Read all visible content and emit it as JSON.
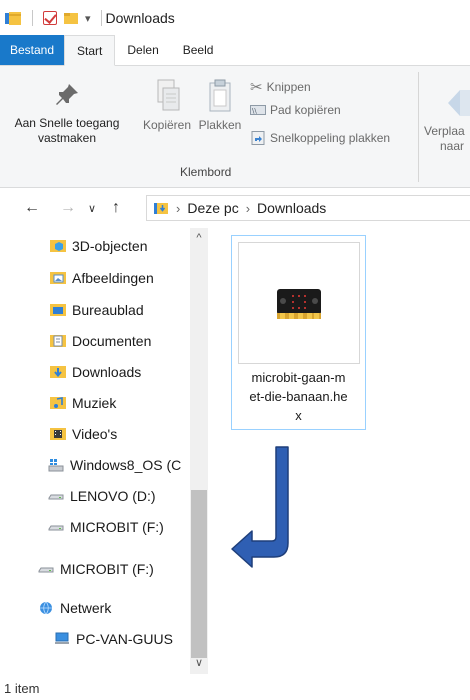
{
  "window": {
    "title": "Downloads"
  },
  "tabs": [
    {
      "label": "Bestand"
    },
    {
      "label": "Start"
    },
    {
      "label": "Delen"
    },
    {
      "label": "Beeld"
    }
  ],
  "ribbon": {
    "pin_label_1": "Aan Snelle toegang",
    "pin_label_2": "vastmaken",
    "copy_label": "Kopiëren",
    "paste_label": "Plakken",
    "cut_label": "Knippen",
    "copy_path_label": "Pad kopiëren",
    "paste_shortcut_label": "Snelkoppeling plakken",
    "group_label": "Klembord",
    "move_label_1": "Verplaa",
    "move_label_2": "naar"
  },
  "address": {
    "crumbs": [
      "Deze pc",
      "Downloads"
    ]
  },
  "nav": {
    "items": [
      {
        "label": "3D-objecten",
        "icon": "3d-objects-folder-icon"
      },
      {
        "label": "Afbeeldingen",
        "icon": "pictures-folder-icon"
      },
      {
        "label": "Bureaublad",
        "icon": "desktop-folder-icon"
      },
      {
        "label": "Documenten",
        "icon": "documents-folder-icon"
      },
      {
        "label": "Downloads",
        "icon": "downloads-folder-icon"
      },
      {
        "label": "Muziek",
        "icon": "music-folder-icon"
      },
      {
        "label": "Video's",
        "icon": "videos-folder-icon"
      },
      {
        "label": "Windows8_OS (C",
        "icon": "windows-drive-icon"
      },
      {
        "label": "LENOVO (D:)",
        "icon": "drive-icon"
      },
      {
        "label": "MICROBIT (F:)",
        "icon": "drive-icon"
      },
      {
        "label": "MICROBIT (F:)",
        "icon": "drive-icon"
      },
      {
        "label": "Netwerk",
        "icon": "network-icon"
      },
      {
        "label": "PC-VAN-GUUS",
        "icon": "computer-icon"
      }
    ]
  },
  "content": {
    "files": [
      {
        "name": "microbit-gaan-met-die-banaan.hex",
        "line1": "microbit-gaan-m",
        "line2": "et-die-banaan.he",
        "line3": "x"
      }
    ]
  },
  "status": {
    "item_count": "1 item"
  },
  "colors": {
    "file_tab": "#1979ca",
    "selection_border": "#99d1ff",
    "arrow_blue": "#2f5fb3",
    "arrow_stroke": "#1f3f7a"
  }
}
